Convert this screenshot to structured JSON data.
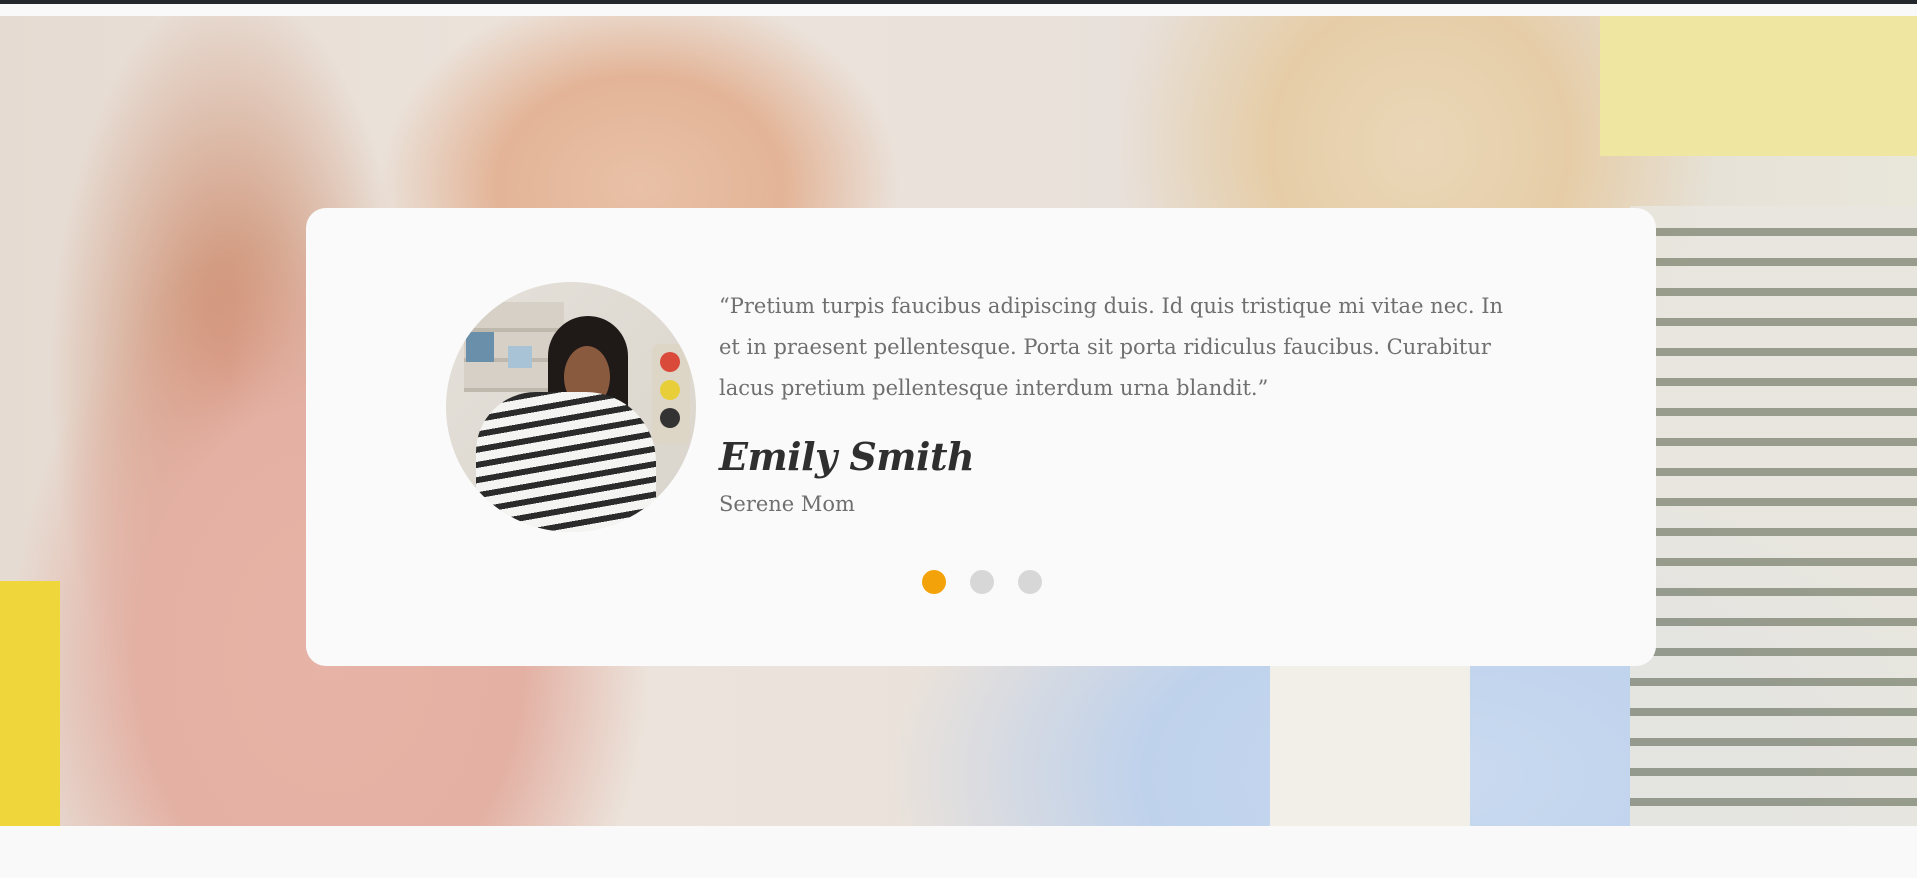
{
  "testimonial": {
    "quote": "“Pretium turpis faucibus adipiscing duis. Id quis tristique mi vitae nec. In et in praesent pellentesque. Porta sit porta ridiculus faucibus. Curabitur lacus pretium pellentesque interdum urna blandit.”",
    "author_name": "Emily Smith",
    "author_role": "Serene Mom",
    "avatar_icon": "person-photo"
  },
  "carousel": {
    "slide_count": 3,
    "active_index": 0,
    "active_color": "#f4a20a",
    "inactive_color": "#d7d7d7"
  }
}
